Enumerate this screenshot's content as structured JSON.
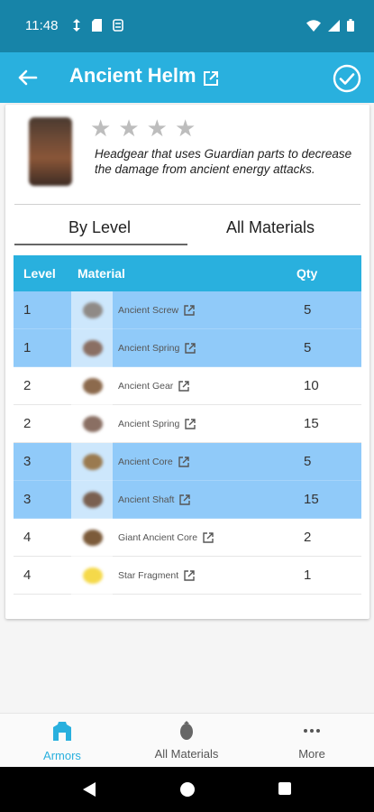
{
  "status_bar": {
    "time": "11:48",
    "left_icons": [
      "data-sync-icon",
      "sim-card-icon",
      "storage-icon"
    ],
    "right_icons": [
      "wifi-icon",
      "signal-icon",
      "battery-icon"
    ]
  },
  "app_bar": {
    "title": "Ancient Helm",
    "back_icon": "arrow-left-icon",
    "link_icon": "open-external-icon",
    "confirm_icon": "check-circle-icon"
  },
  "item": {
    "image": "ancient-helm-image",
    "rating": 0,
    "max_rating": 4,
    "description": "Headgear that uses Guardian parts to decrease the damage from ancient energy attacks."
  },
  "tabs": [
    {
      "label": "By Level",
      "selected": true
    },
    {
      "label": "All Materials",
      "selected": false
    }
  ],
  "table": {
    "headers": {
      "level": "Level",
      "material": "Material",
      "qty": "Qty"
    },
    "rows": [
      {
        "level": "1",
        "material": "Ancient Screw",
        "qty": "5",
        "highlight": true,
        "color": "#8f8a86"
      },
      {
        "level": "1",
        "material": "Ancient Spring",
        "qty": "5",
        "highlight": true,
        "color": "#8a6f63"
      },
      {
        "level": "2",
        "material": "Ancient Gear",
        "qty": "10",
        "highlight": false,
        "color": "#8c6a4d"
      },
      {
        "level": "2",
        "material": "Ancient Spring",
        "qty": "15",
        "highlight": false,
        "color": "#8a6f63"
      },
      {
        "level": "3",
        "material": "Ancient Core",
        "qty": "5",
        "highlight": true,
        "color": "#9a7a50"
      },
      {
        "level": "3",
        "material": "Ancient Shaft",
        "qty": "15",
        "highlight": true,
        "color": "#7a6050"
      },
      {
        "level": "4",
        "material": "Giant Ancient Core",
        "qty": "2",
        "highlight": false,
        "color": "#7c5b3a"
      },
      {
        "level": "4",
        "material": "Star Fragment",
        "qty": "1",
        "highlight": false,
        "color": "#f5d94a"
      }
    ]
  },
  "bottom_nav": [
    {
      "label": "Armors",
      "icon": "armor-icon",
      "active": true
    },
    {
      "label": "All Materials",
      "icon": "material-icon",
      "active": false
    },
    {
      "label": "More",
      "icon": "more-dots-icon",
      "active": false
    }
  ],
  "colors": {
    "status_bar": "#1784a8",
    "primary": "#29b0de",
    "row_highlight": "#90caf9",
    "star_empty": "#bdbdbd"
  }
}
